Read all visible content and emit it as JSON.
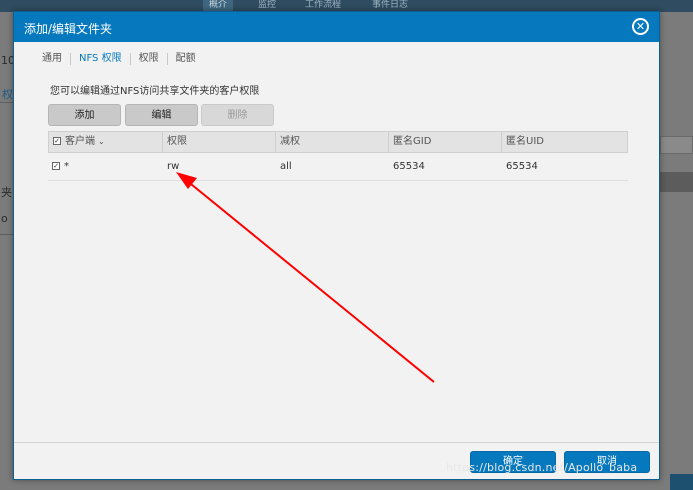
{
  "background": {
    "tabs": [
      "概介",
      "监控",
      "工作流程",
      "事件日志"
    ],
    "fragments": {
      "left_number": "10",
      "left_link": "权",
      "left_text_1": "夹",
      "left_text_2": "o"
    }
  },
  "dialog": {
    "title": "添加/编辑文件夹",
    "close_glyph": "✕",
    "tabs": [
      {
        "label": "通用"
      },
      {
        "label": "NFS 权限"
      },
      {
        "label": "权限"
      },
      {
        "label": "配额"
      }
    ],
    "description": "您可以编辑通过NFS访问共享文件夹的客户权限",
    "toolbar": {
      "add": "添加",
      "edit": "编辑",
      "delete": "删除"
    },
    "table": {
      "columns": [
        "客户端",
        "权限",
        "减权",
        "匿名GID",
        "匿名UID"
      ],
      "rows": [
        {
          "client": "*",
          "privilege": "rw",
          "squash": "all",
          "anon_gid": "65534",
          "anon_uid": "65534"
        }
      ]
    },
    "footer": {
      "ok": "确定",
      "cancel": "取消"
    }
  },
  "watermark": "https://blog.csdn.net/Apollo_baba",
  "colors": {
    "accent": "#0678be",
    "annotation_arrow": "#ff0000"
  }
}
